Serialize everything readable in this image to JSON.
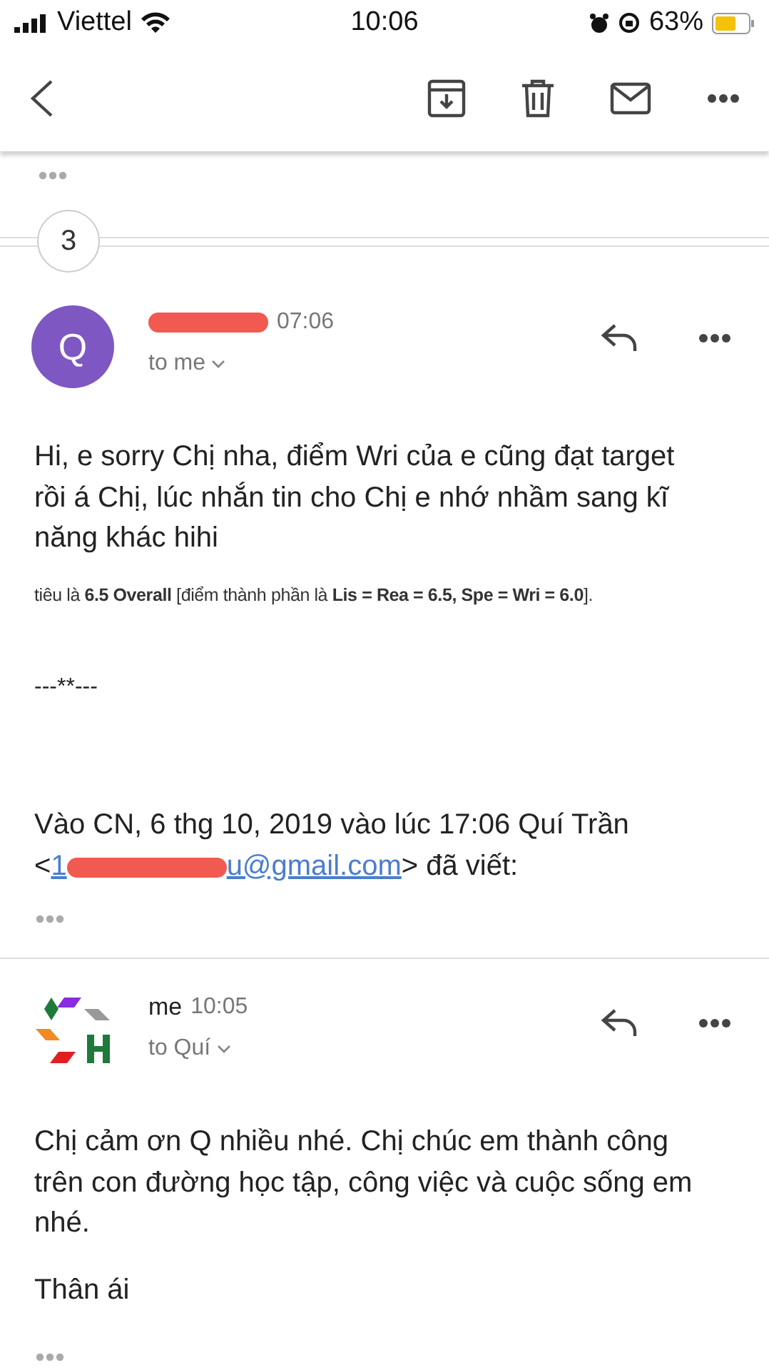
{
  "status_bar": {
    "carrier": "Viettel",
    "time": "10:06",
    "battery": "63%"
  },
  "thread": {
    "collapsed_count": "3"
  },
  "messages": [
    {
      "avatar": {
        "kind": "letter",
        "letter": "Q"
      },
      "sender_redacted": true,
      "time": "07:06",
      "recipient": "to me",
      "blocks": [
        {
          "kind": "paragraph",
          "text": "Hi, e sorry Chị nha, điểm Wri của e cũng đạt target rồi á Chị, lúc nhắn tin cho Chị e nhớ nhầm sang kĩ năng khác hihi"
        },
        {
          "kind": "fine_print",
          "text": "tiêu là **6.5 Overall** [điểm thành phần là **Lis = Rea = 6.5, Spe = Wri = 6.0**]."
        },
        {
          "kind": "separator",
          "text": "---**---"
        },
        {
          "kind": "quote_header",
          "text": "Vào CN, 6 thg 10, 2019 vào lúc 17:06 Quí Trần <",
          "link_start": "1",
          "link_end": "u@gmail.com",
          "after": "> đã viết:"
        }
      ]
    },
    {
      "avatar": {
        "kind": "logo"
      },
      "sender_redacted": false,
      "sender": "me",
      "time": "10:05",
      "recipient": "to Quí",
      "blocks": [
        {
          "kind": "paragraph",
          "text": "Chị cảm ơn Q nhiều nhé. Chị chúc em thành công trên con đường học tập, công việc và cuộc sống em nhé."
        },
        {
          "kind": "paragraph",
          "text": "Thân ái"
        }
      ]
    }
  ]
}
